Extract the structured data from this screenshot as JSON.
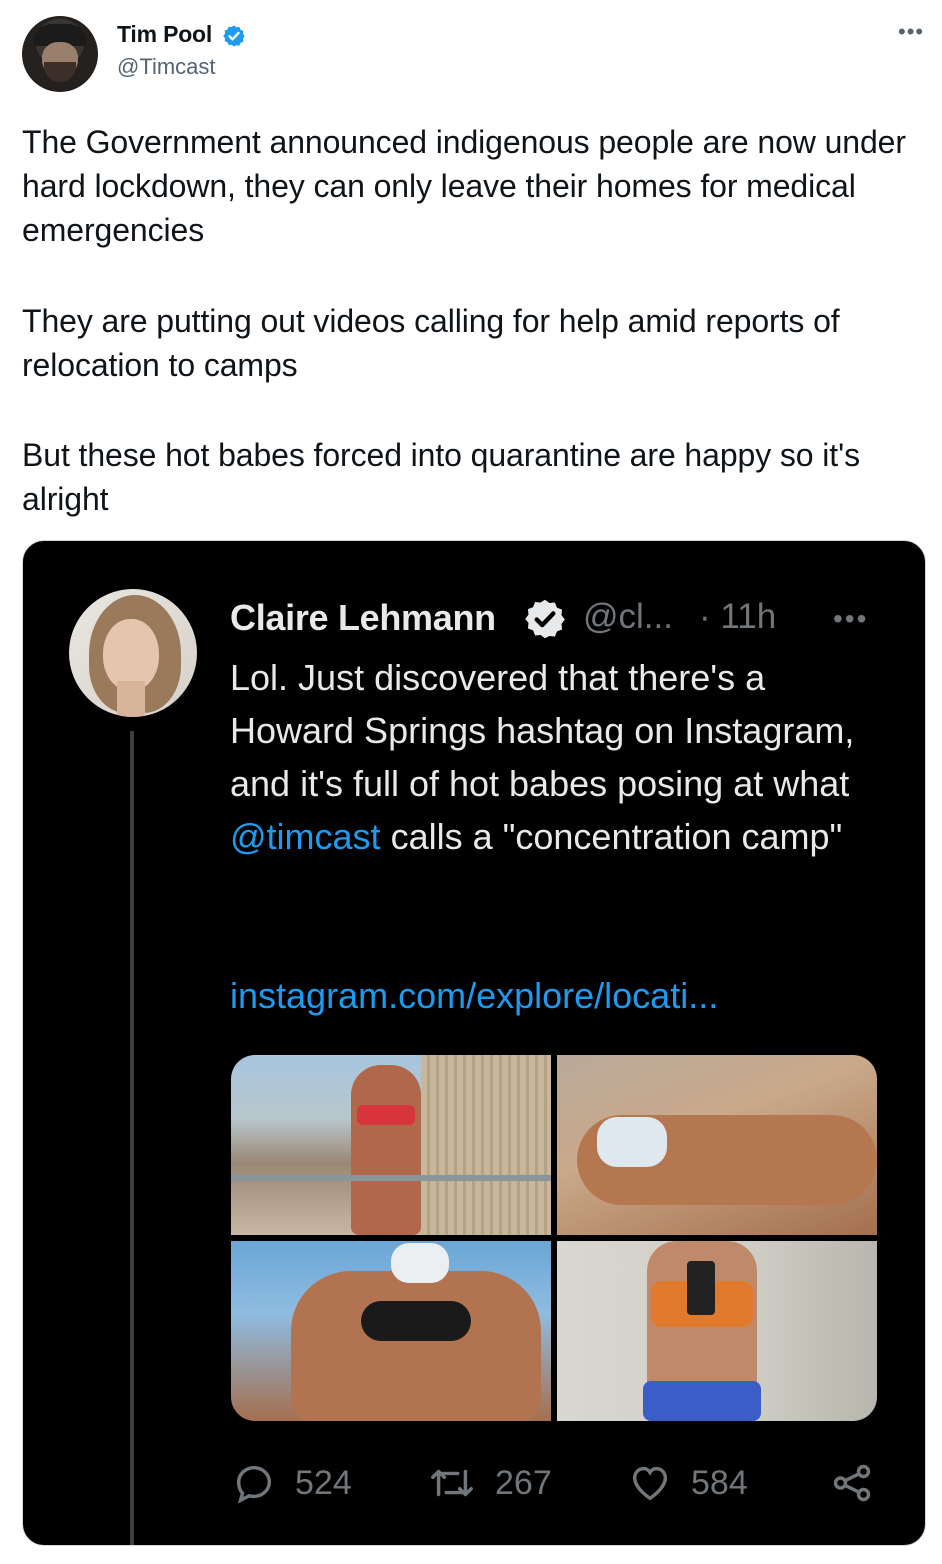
{
  "tweet": {
    "author": {
      "name": "Tim Pool",
      "handle": "@Timcast",
      "verified": true
    },
    "more_icon": "ellipsis-icon",
    "paragraphs": [
      "The Government announced indigenous people are now under hard lockdown, they can only leave their homes for medical emergencies",
      "They are putting out videos calling for help amid reports of relocation to camps",
      "But these hot babes forced into quarantine are happy so it's alright"
    ]
  },
  "embedded_tweet": {
    "author": {
      "name": "Claire Lehmann",
      "handle": "@cl...",
      "time": "· 11h",
      "verified": true
    },
    "text_before_mention": "Lol. Just discovered that there's a Howard Springs hashtag on Instagram, and it's full of hot babes posing at what ",
    "mention": "@timcast",
    "text_after_mention": " calls a \"concentration camp\"",
    "link": "instagram.com/explore/locati...",
    "media_count": 4,
    "actions": {
      "replies": "524",
      "retweets": "267",
      "likes": "584"
    }
  },
  "colors": {
    "verified_blue": "#1d9bf0",
    "link_blue": "#1d9bf0",
    "embed_background": "#000000",
    "muted_gray": "#71767b"
  }
}
